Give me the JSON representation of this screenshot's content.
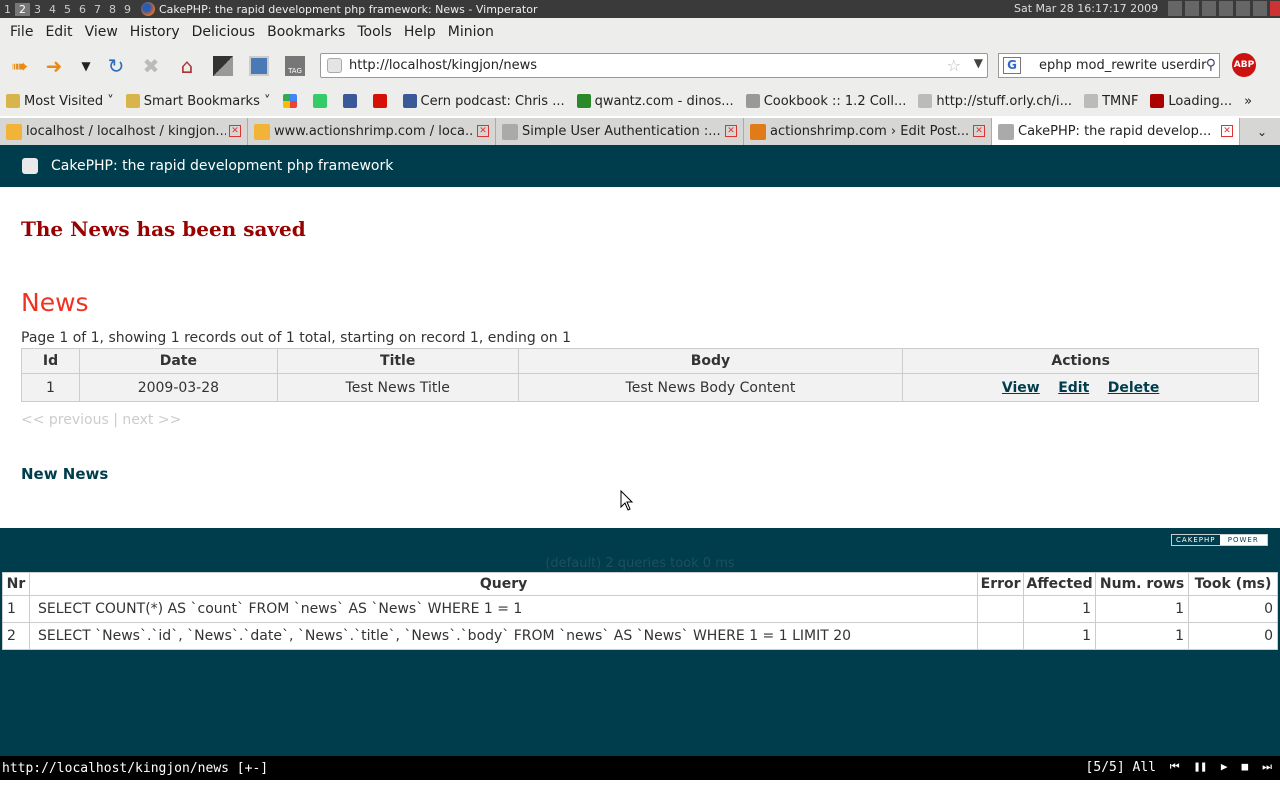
{
  "system_bar": {
    "workspaces": [
      "1",
      "2",
      "3",
      "4",
      "5",
      "6",
      "7",
      "8",
      "9"
    ],
    "window_title": "CakePHP: the rapid development php framework: News - Vimperator",
    "clock": "Sat Mar 28 16:17:17 2009"
  },
  "menu": [
    "File",
    "Edit",
    "View",
    "History",
    "Delicious",
    "Bookmarks",
    "Tools",
    "Help",
    "Minion"
  ],
  "url": "http://localhost/kingjon/news",
  "search_value": "ephp mod_rewrite userdir",
  "abp_label": "ABP",
  "bookmarks": [
    {
      "label": "Most Visited",
      "icon": "folder-icon",
      "menu": true
    },
    {
      "label": "Smart Bookmarks",
      "icon": "folder-icon",
      "menu": true
    },
    {
      "label": "",
      "icon": "google-icon"
    },
    {
      "label": "",
      "icon": "delicious-icon"
    },
    {
      "label": "",
      "icon": "facebook-icon"
    },
    {
      "label": "",
      "icon": "lastfm-icon"
    },
    {
      "label": "Cern podcast: Chris ...",
      "icon": "page-icon"
    },
    {
      "label": "qwantz.com - dinos...",
      "icon": "dino-icon"
    },
    {
      "label": "Cookbook :: 1.2 Coll...",
      "icon": "cake-icon"
    },
    {
      "label": "http://stuff.orly.ch/i...",
      "icon": "page-icon"
    },
    {
      "label": "TMNF",
      "icon": "page-icon"
    },
    {
      "label": "Loading...",
      "icon": "yahoo-icon"
    }
  ],
  "tabs": [
    {
      "title": "localhost / localhost / kingjon...",
      "icon": "pma-icon",
      "active": false
    },
    {
      "title": "www.actionshrimp.com / loca...",
      "icon": "pma-icon",
      "active": false
    },
    {
      "title": "Simple User Authentication :...",
      "icon": "cake-icon",
      "active": false
    },
    {
      "title": "actionshrimp.com › Edit Post...",
      "icon": "wordpress-icon",
      "active": false
    },
    {
      "title": "CakePHP: the rapid develop...",
      "icon": "cake-icon",
      "active": true
    }
  ],
  "page": {
    "header_title": "CakePHP: the rapid development php framework",
    "flash": "The News has been saved",
    "heading": "News",
    "paging_info": "Page 1 of 1, showing 1 records out of 1 total, starting on record 1, ending on 1",
    "columns": [
      "Id",
      "Date",
      "Title",
      "Body",
      "Actions"
    ],
    "rows": [
      {
        "id": "1",
        "date": "2009-03-28",
        "title": "Test News Title",
        "body": "Test News Body Content"
      }
    ],
    "actions": [
      "View",
      "Edit",
      "Delete"
    ],
    "pager": {
      "previous": "<< previous",
      "separator": "|",
      "next": "next >>"
    },
    "new_link": "New News"
  },
  "footer": {
    "powered_badge": [
      "CAKEPHP",
      "POWER"
    ],
    "sql_summary": "(default) 2 queries took 0 ms",
    "sql_columns": [
      "Nr",
      "Query",
      "Error",
      "Affected",
      "Num. rows",
      "Took (ms)"
    ],
    "sql_rows": [
      {
        "nr": "1",
        "query": "SELECT COUNT(*) AS `count` FROM `news` AS `News` WHERE 1 = 1",
        "error": "",
        "affected": "1",
        "num_rows": "1",
        "took": "0"
      },
      {
        "nr": "2",
        "query": "SELECT `News`.`id`, `News`.`date`, `News`.`title`, `News`.`body` FROM `news` AS `News` WHERE 1 = 1 LIMIT 20",
        "error": "",
        "affected": "1",
        "num_rows": "1",
        "took": "0"
      }
    ]
  },
  "status_bar": {
    "left": "http://localhost/kingjon/news [+-]",
    "right": "[5/5] All"
  },
  "colors": {
    "cake_teal": "#003d4c",
    "flash_red": "#990000",
    "heading_red": "#ee3322"
  }
}
